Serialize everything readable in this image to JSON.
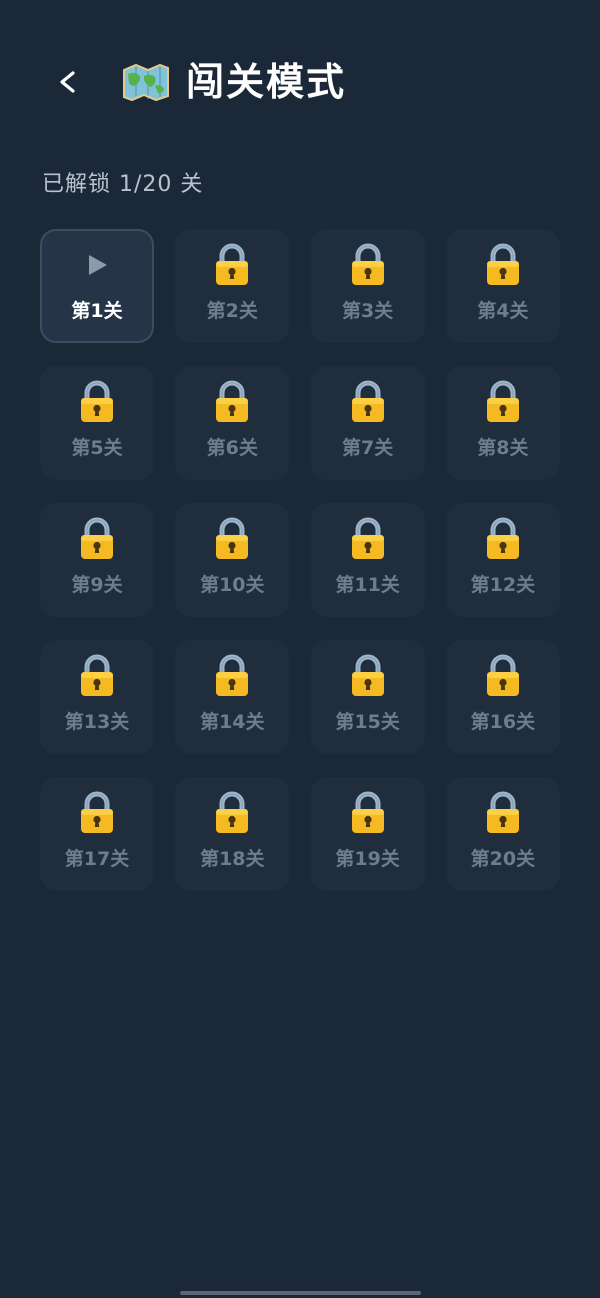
{
  "header": {
    "back_label": "<",
    "title": "闯关模式",
    "map_icon": "world-map-icon"
  },
  "progress_text": "已解锁 1/20 关",
  "levels": [
    {
      "label": "第1关",
      "status": "unlocked",
      "icon": "play-icon"
    },
    {
      "label": "第2关",
      "status": "locked",
      "icon": "lock-icon"
    },
    {
      "label": "第3关",
      "status": "locked",
      "icon": "lock-icon"
    },
    {
      "label": "第4关",
      "status": "locked",
      "icon": "lock-icon"
    },
    {
      "label": "第5关",
      "status": "locked",
      "icon": "lock-icon"
    },
    {
      "label": "第6关",
      "status": "locked",
      "icon": "lock-icon"
    },
    {
      "label": "第7关",
      "status": "locked",
      "icon": "lock-icon"
    },
    {
      "label": "第8关",
      "status": "locked",
      "icon": "lock-icon"
    },
    {
      "label": "第9关",
      "status": "locked",
      "icon": "lock-icon"
    },
    {
      "label": "第10关",
      "status": "locked",
      "icon": "lock-icon"
    },
    {
      "label": "第11关",
      "status": "locked",
      "icon": "lock-icon"
    },
    {
      "label": "第12关",
      "status": "locked",
      "icon": "lock-icon"
    },
    {
      "label": "第13关",
      "status": "locked",
      "icon": "lock-icon"
    },
    {
      "label": "第14关",
      "status": "locked",
      "icon": "lock-icon"
    },
    {
      "label": "第15关",
      "status": "locked",
      "icon": "lock-icon"
    },
    {
      "label": "第16关",
      "status": "locked",
      "icon": "lock-icon"
    },
    {
      "label": "第17关",
      "status": "locked",
      "icon": "lock-icon"
    },
    {
      "label": "第18关",
      "status": "locked",
      "icon": "lock-icon"
    },
    {
      "label": "第19关",
      "status": "locked",
      "icon": "lock-icon"
    },
    {
      "label": "第20关",
      "status": "locked",
      "icon": "lock-icon"
    }
  ],
  "colors": {
    "background": "#1b2838",
    "tile_locked": "#1f2d3d",
    "tile_unlocked": "#253446",
    "lock_gold": "#f5b921",
    "shackle_blue": "#9fb7cc"
  }
}
